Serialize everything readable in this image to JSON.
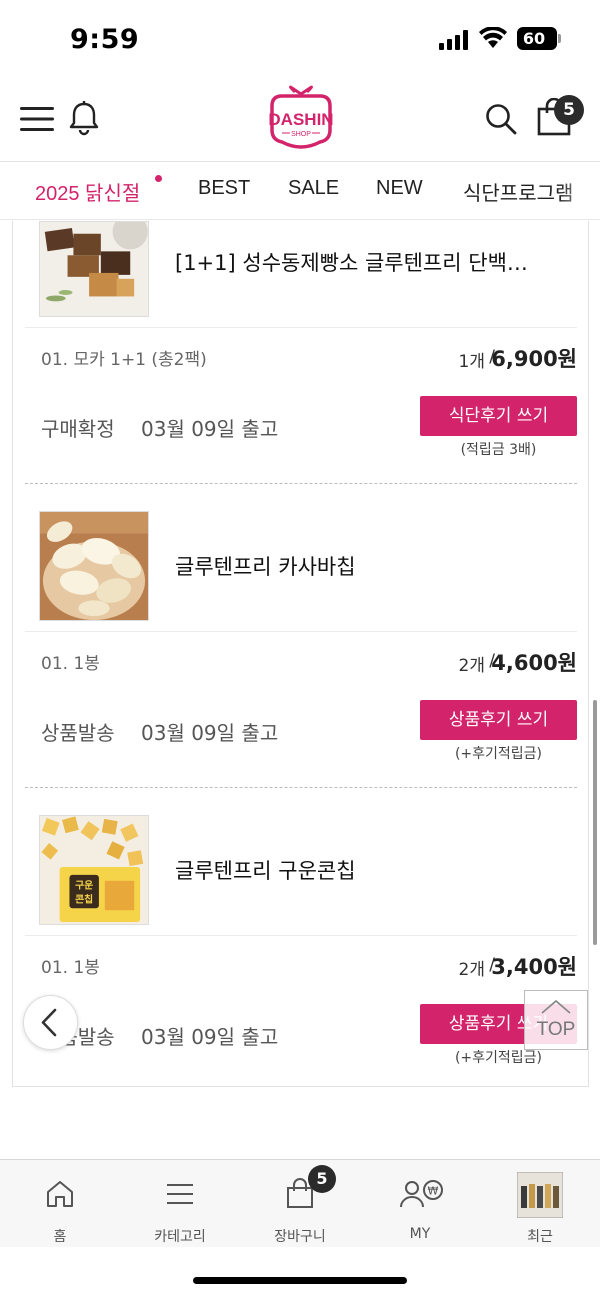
{
  "status_bar": {
    "time": "9:59",
    "battery": "60"
  },
  "header": {
    "logo_text": "DASHIN",
    "logo_sub": "SHOP",
    "cart_count": "5"
  },
  "category_tabs": [
    {
      "label": "2025 닭신절"
    },
    {
      "label": "BEST"
    },
    {
      "label": "SALE"
    },
    {
      "label": "NEW"
    },
    {
      "label": "식단프로그램"
    }
  ],
  "order_items": [
    {
      "name": "[1+1] 성수동제빵소 글루텐프리 단백…",
      "option": "01. 모카 1+1 (총2팩)",
      "qty": "1개",
      "slash": "/",
      "price": "6,900원",
      "status": "구매확정",
      "ship_date": "03월 09일 출고",
      "review_button": "식단후기 쓰기",
      "review_note": "(적립금 3배)"
    },
    {
      "name": "글루텐프리 카사바칩",
      "option": "01. 1봉",
      "qty": "2개",
      "slash": "/",
      "price": "4,600원",
      "status": "상품발송",
      "ship_date": "03월 09일 출고",
      "review_button": "상품후기 쓰기",
      "review_note": "(+후기적립금)"
    },
    {
      "name": "글루텐프리 구운콘칩",
      "option": "01. 1봉",
      "qty": "2개",
      "slash": "/",
      "price": "3,400원",
      "status": "상품발송",
      "ship_date": "03월 09일 출고",
      "review_button": "상품후기 쓰기",
      "review_note": "(+후기적립금)",
      "package_text": "구운\n콘칩"
    }
  ],
  "floating": {
    "top_label": "TOP"
  },
  "tab_bar": {
    "items": [
      {
        "label": "홈",
        "icon": "home-icon"
      },
      {
        "label": "카테고리",
        "icon": "list-icon"
      },
      {
        "label": "장바구니",
        "icon": "shopping-bag-icon"
      },
      {
        "label": "MY",
        "icon": "user-won-icon"
      },
      {
        "label": "최근",
        "icon": "recent-thumbnail"
      }
    ],
    "cart_badge": "5"
  },
  "colors": {
    "accent": "#d3246b",
    "text": "#222222",
    "muted": "#666666"
  }
}
